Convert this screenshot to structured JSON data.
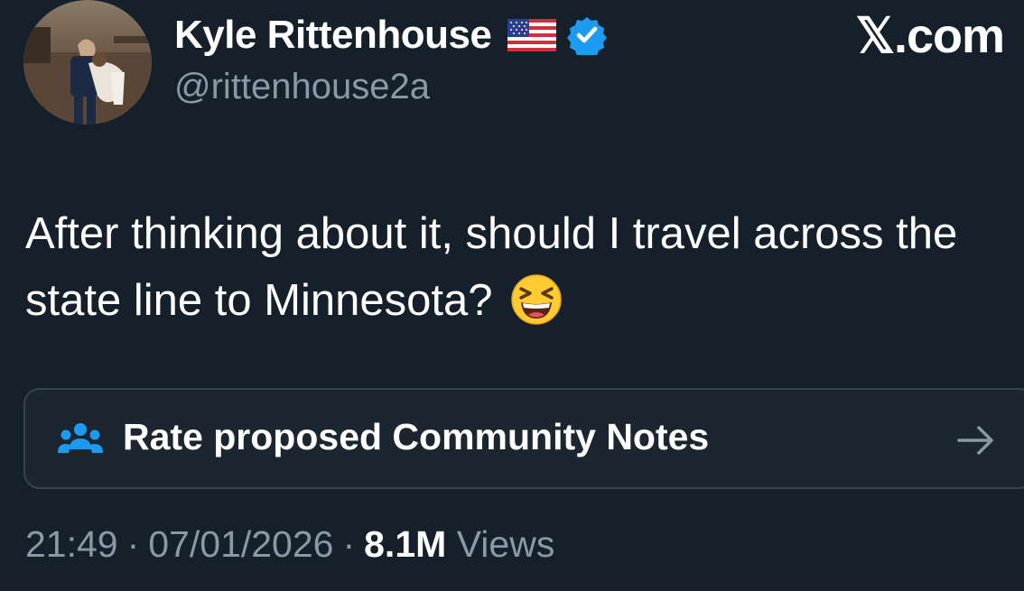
{
  "author": {
    "display_name": "Kyle Rittenhouse",
    "flag_icon": "us-flag-icon",
    "verified_icon": "verified-badge-icon",
    "verified_color": "#1d9bf0",
    "handle": "@rittenhouse2a"
  },
  "brand": {
    "label": "𝕏.com"
  },
  "tweet": {
    "text": "After thinking about it, should I travel across the state line to Minnesota?",
    "emoji_icon": "grinning-squinting-face-icon"
  },
  "community_notes": {
    "label": "Rate proposed Community Notes",
    "icon": "people-icon",
    "icon_color": "#1d9bf0",
    "arrow_icon": "arrow-right-icon"
  },
  "meta": {
    "time": "21:49",
    "date": "07/01/2026",
    "views_count": "8.1M",
    "views_label": "Views",
    "separator": "·"
  },
  "colors": {
    "background": "#15202b",
    "secondary_text": "#8b98a5",
    "border": "#38444d"
  }
}
